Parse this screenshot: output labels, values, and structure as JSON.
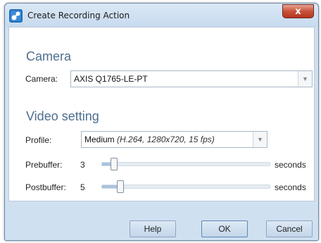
{
  "window": {
    "title": "Create Recording Action",
    "close_symbol": "x"
  },
  "camera_section": {
    "heading": "Camera",
    "camera_label": "Camera:",
    "camera_value": "AXIS Q1765-LE-PT"
  },
  "video_section": {
    "heading": "Video setting",
    "profile_label": "Profile:",
    "profile_value": "Medium",
    "profile_detail": "(H.264, 1280x720, 15 fps)",
    "prebuffer_label": "Prebuffer:",
    "prebuffer_value": "3",
    "prebuffer_unit": "seconds",
    "postbuffer_label": "Postbuffer:",
    "postbuffer_value": "5",
    "postbuffer_unit": "seconds"
  },
  "buttons": {
    "help": "Help",
    "ok": "OK",
    "cancel": "Cancel"
  },
  "icons": {
    "app": "recording-app-icon",
    "dropdown": "chevron-down-icon",
    "close": "close-icon"
  }
}
